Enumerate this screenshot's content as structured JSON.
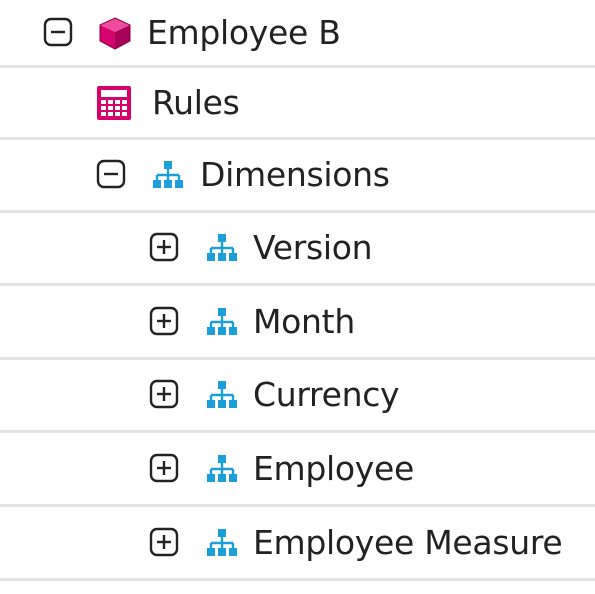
{
  "colors": {
    "cube": "#d6006e",
    "rules": "#d6006e",
    "dimension": "#1a9fd8",
    "divider": "#e4e4e4",
    "toggle": "#222222",
    "text": "#222222"
  },
  "tree": {
    "root": {
      "label": "Employee B",
      "icon": "cube-icon",
      "state": "expanded"
    },
    "rules": {
      "label": "Rules",
      "icon": "calculator-icon"
    },
    "dimensions": {
      "label": "Dimensions",
      "icon": "hierarchy-icon",
      "state": "expanded"
    },
    "items": [
      {
        "label": "Version",
        "icon": "hierarchy-icon",
        "state": "collapsed"
      },
      {
        "label": "Month",
        "icon": "hierarchy-icon",
        "state": "collapsed"
      },
      {
        "label": "Currency",
        "icon": "hierarchy-icon",
        "state": "collapsed"
      },
      {
        "label": "Employee",
        "icon": "hierarchy-icon",
        "state": "collapsed"
      },
      {
        "label": "Employee Measure",
        "icon": "hierarchy-icon",
        "state": "collapsed"
      }
    ]
  }
}
